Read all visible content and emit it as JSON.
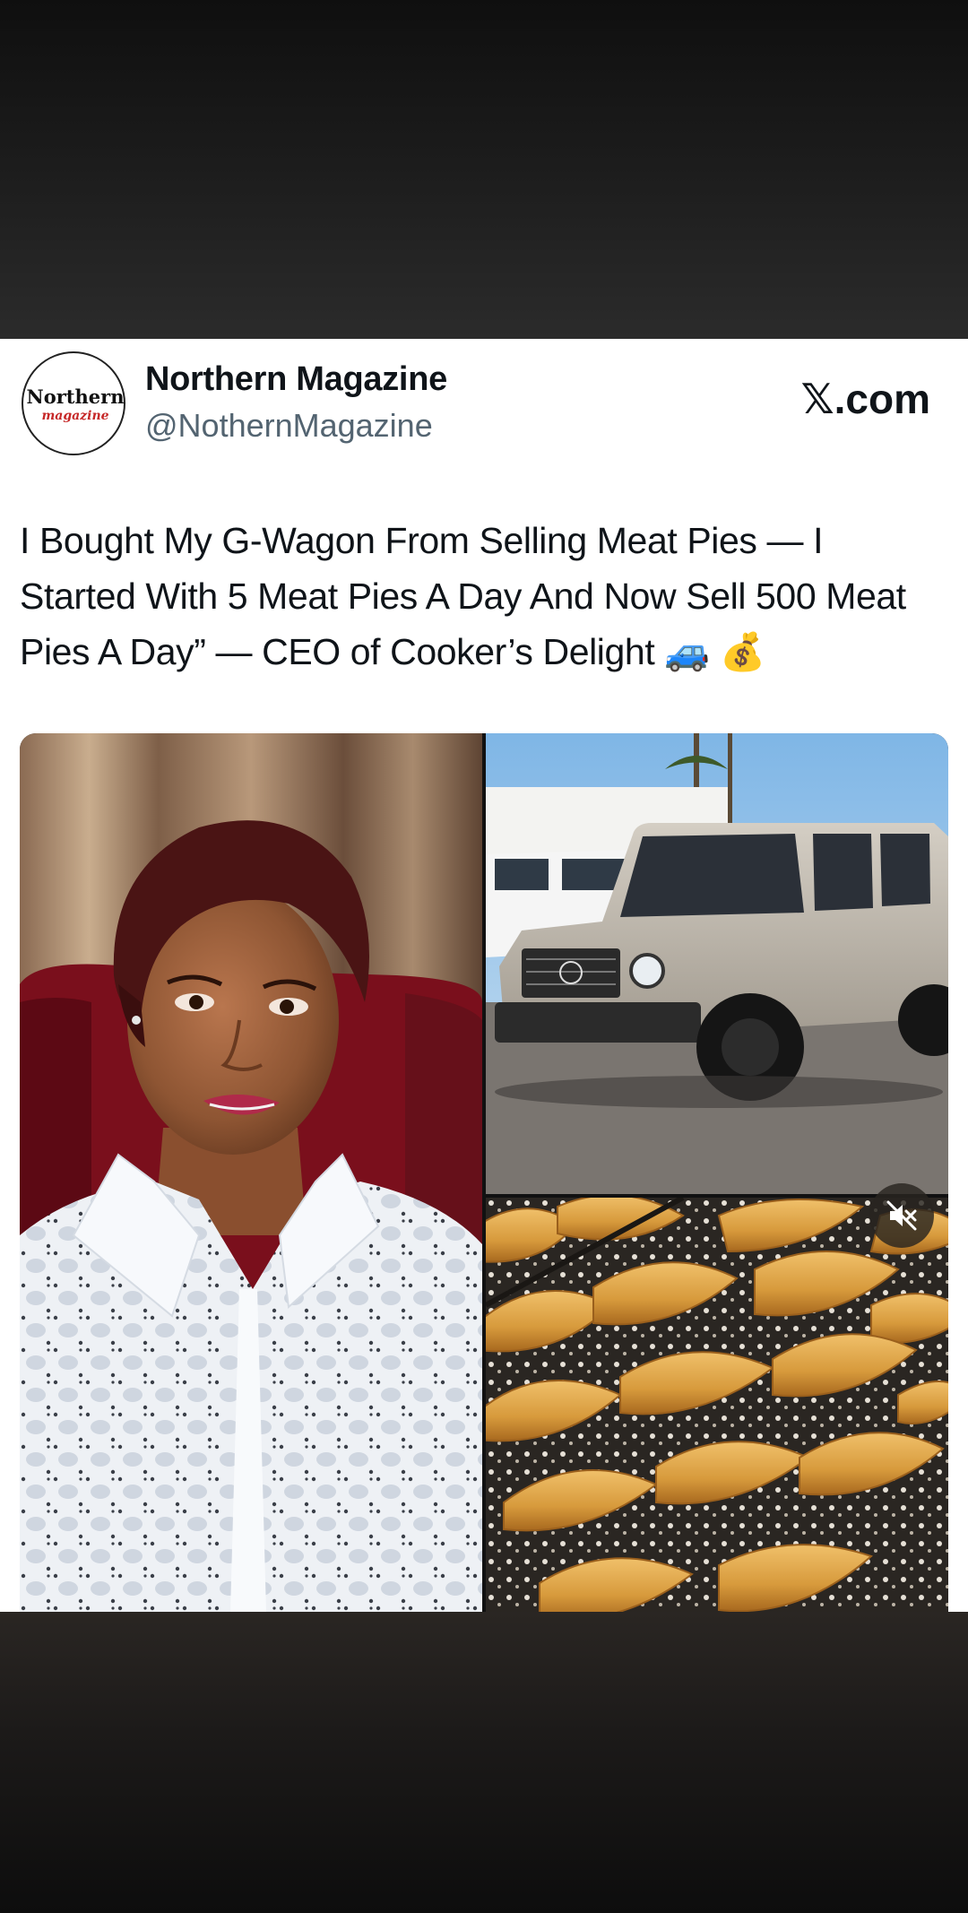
{
  "post": {
    "account_name": "Northern Magazine",
    "account_handle": "@NothernMagazine",
    "avatar_text_line1": "Northern",
    "avatar_text_line2": "magazine",
    "brand_x": "𝕏",
    "brand_suffix": ".com",
    "headline": "I Bought My G-Wagon From Selling Meat Pies — I Started With 5 Meat Pies A Day And Now Sell 500 Meat Pies A Day” — CEO of Cooker’s Delight 🚙 💰"
  },
  "media": {
    "photos": [
      "woman-portrait",
      "g-wagon",
      "meat-pies"
    ],
    "mute_icon": "speaker-muted-icon"
  },
  "colors": {
    "card_bg": "#ffffff",
    "text_primary": "#0f1419",
    "text_secondary": "#536471"
  }
}
